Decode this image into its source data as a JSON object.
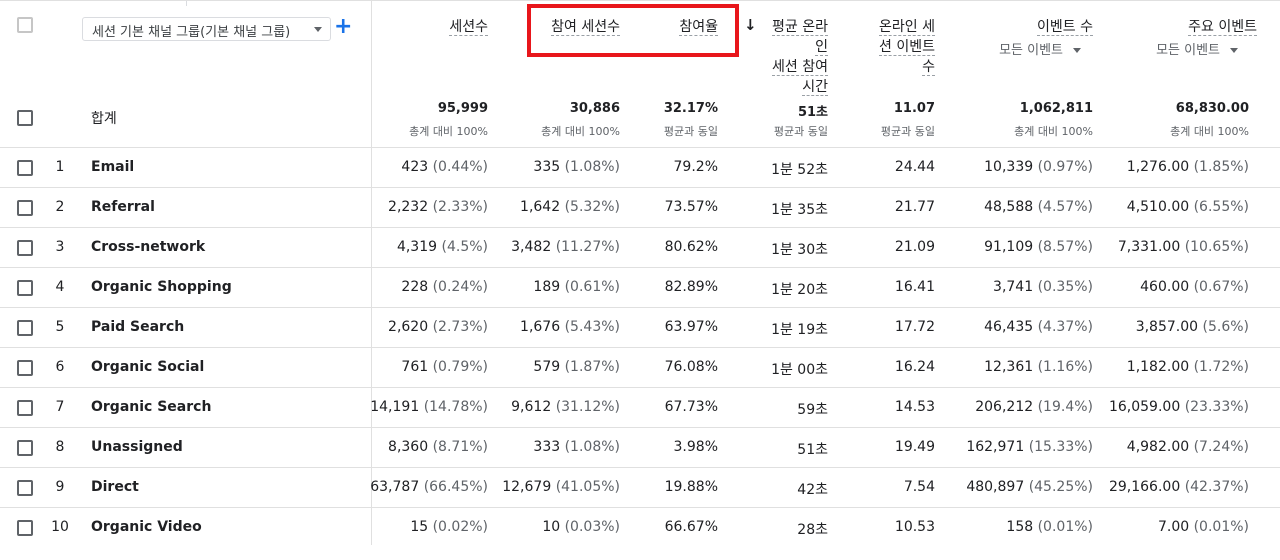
{
  "dimension_selector": {
    "label": "세션 기본 채널 그룹(기본 채널 그룹)"
  },
  "headers": [
    {
      "id": "sessions",
      "lines": [
        "세션수"
      ]
    },
    {
      "id": "engaged_sessions",
      "lines": [
        "참여 세션수"
      ]
    },
    {
      "id": "engagement_rate",
      "lines": [
        "참여율"
      ]
    },
    {
      "id": "avg_engagement_time",
      "lines": [
        "평균 온라인",
        "세션 참여",
        "시간"
      ],
      "sorted": true
    },
    {
      "id": "events_per_session",
      "lines": [
        "온라인 세",
        "션 이벤트",
        "수"
      ]
    },
    {
      "id": "event_count",
      "lines": [
        "이벤트 수"
      ],
      "subselect": "모든 이벤트"
    },
    {
      "id": "key_events",
      "lines": [
        "주요 이벤트"
      ],
      "subselect": "모든 이벤트"
    }
  ],
  "totals": {
    "label": "합계",
    "values": [
      "95,999",
      "30,886",
      "32.17%",
      "51초",
      "11.07",
      "1,062,811",
      "68,830.00"
    ],
    "subs": [
      "총계 대비 100%",
      "총계 대비 100%",
      "평균과 동일",
      "평균과 동일",
      "평균과 동일",
      "총계 대비 100%",
      "총계 대비 100%"
    ]
  },
  "rows": [
    {
      "num": "1",
      "name": "Email",
      "cells": [
        [
          "423",
          "(0.44%)"
        ],
        [
          "335",
          "(1.08%)"
        ],
        [
          "79.2%",
          ""
        ],
        [
          "1분 52초",
          ""
        ],
        [
          "24.44",
          ""
        ],
        [
          "10,339",
          "(0.97%)"
        ],
        [
          "1,276.00",
          "(1.85%)"
        ]
      ]
    },
    {
      "num": "2",
      "name": "Referral",
      "cells": [
        [
          "2,232",
          "(2.33%)"
        ],
        [
          "1,642",
          "(5.32%)"
        ],
        [
          "73.57%",
          ""
        ],
        [
          "1분 35초",
          ""
        ],
        [
          "21.77",
          ""
        ],
        [
          "48,588",
          "(4.57%)"
        ],
        [
          "4,510.00",
          "(6.55%)"
        ]
      ]
    },
    {
      "num": "3",
      "name": "Cross-network",
      "cells": [
        [
          "4,319",
          "(4.5%)"
        ],
        [
          "3,482",
          "(11.27%)"
        ],
        [
          "80.62%",
          ""
        ],
        [
          "1분 30초",
          ""
        ],
        [
          "21.09",
          ""
        ],
        [
          "91,109",
          "(8.57%)"
        ],
        [
          "7,331.00",
          "(10.65%)"
        ]
      ]
    },
    {
      "num": "4",
      "name": "Organic Shopping",
      "cells": [
        [
          "228",
          "(0.24%)"
        ],
        [
          "189",
          "(0.61%)"
        ],
        [
          "82.89%",
          ""
        ],
        [
          "1분 20초",
          ""
        ],
        [
          "16.41",
          ""
        ],
        [
          "3,741",
          "(0.35%)"
        ],
        [
          "460.00",
          "(0.67%)"
        ]
      ]
    },
    {
      "num": "5",
      "name": "Paid Search",
      "cells": [
        [
          "2,620",
          "(2.73%)"
        ],
        [
          "1,676",
          "(5.43%)"
        ],
        [
          "63.97%",
          ""
        ],
        [
          "1분 19초",
          ""
        ],
        [
          "17.72",
          ""
        ],
        [
          "46,435",
          "(4.37%)"
        ],
        [
          "3,857.00",
          "(5.6%)"
        ]
      ]
    },
    {
      "num": "6",
      "name": "Organic Social",
      "cells": [
        [
          "761",
          "(0.79%)"
        ],
        [
          "579",
          "(1.87%)"
        ],
        [
          "76.08%",
          ""
        ],
        [
          "1분 00초",
          ""
        ],
        [
          "16.24",
          ""
        ],
        [
          "12,361",
          "(1.16%)"
        ],
        [
          "1,182.00",
          "(1.72%)"
        ]
      ]
    },
    {
      "num": "7",
      "name": "Organic Search",
      "cells": [
        [
          "14,191",
          "(14.78%)"
        ],
        [
          "9,612",
          "(31.12%)"
        ],
        [
          "67.73%",
          ""
        ],
        [
          "59초",
          ""
        ],
        [
          "14.53",
          ""
        ],
        [
          "206,212",
          "(19.4%)"
        ],
        [
          "16,059.00",
          "(23.33%)"
        ]
      ]
    },
    {
      "num": "8",
      "name": "Unassigned",
      "cells": [
        [
          "8,360",
          "(8.71%)"
        ],
        [
          "333",
          "(1.08%)"
        ],
        [
          "3.98%",
          ""
        ],
        [
          "51초",
          ""
        ],
        [
          "19.49",
          ""
        ],
        [
          "162,971",
          "(15.33%)"
        ],
        [
          "4,982.00",
          "(7.24%)"
        ]
      ]
    },
    {
      "num": "9",
      "name": "Direct",
      "cells": [
        [
          "63,787",
          "(66.45%)"
        ],
        [
          "12,679",
          "(41.05%)"
        ],
        [
          "19.88%",
          ""
        ],
        [
          "42초",
          ""
        ],
        [
          "7.54",
          ""
        ],
        [
          "480,897",
          "(45.25%)"
        ],
        [
          "29,166.00",
          "(42.37%)"
        ]
      ]
    },
    {
      "num": "10",
      "name": "Organic Video",
      "cells": [
        [
          "15",
          "(0.02%)"
        ],
        [
          "10",
          "(0.03%)"
        ],
        [
          "66.67%",
          ""
        ],
        [
          "28초",
          ""
        ],
        [
          "10.53",
          ""
        ],
        [
          "158",
          "(0.01%)"
        ],
        [
          "7.00",
          "(0.01%)"
        ]
      ]
    }
  ],
  "colors": {
    "highlight_border": "#e8161b",
    "add_button": "#1a73e8"
  },
  "icons": {
    "add": "plus-icon",
    "sort": "arrow-down-icon",
    "dropdown": "caret-down-icon"
  }
}
